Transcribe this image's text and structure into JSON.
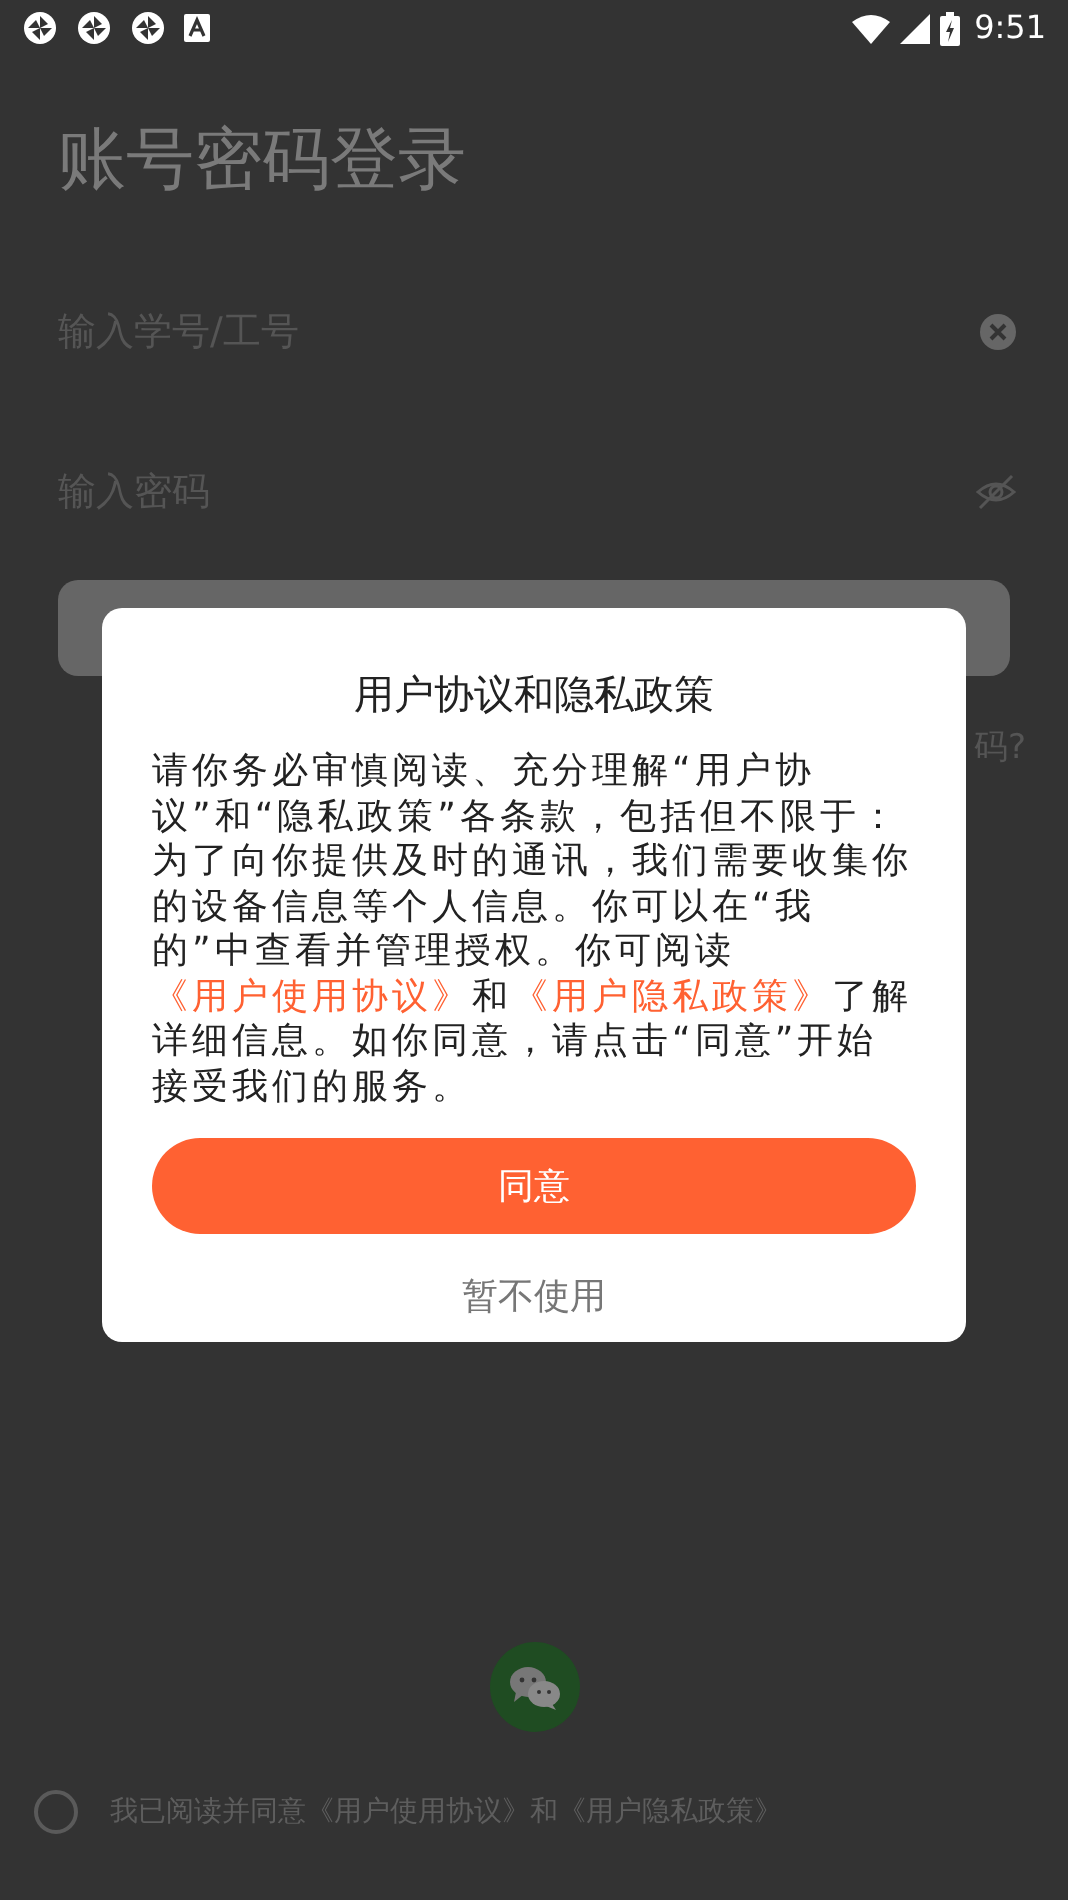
{
  "status_bar": {
    "time": "9:51"
  },
  "page": {
    "title": "账号密码登录",
    "account_field": {
      "placeholder": "输入学号/工号"
    },
    "password_field": {
      "placeholder": "输入密码"
    },
    "forgot_link": "码?"
  },
  "agreement": {
    "checked": false,
    "text": "我已阅读并同意《用户使用协议》和《用户隐私政策》"
  },
  "dialog": {
    "title": "用户协议和隐私政策",
    "body": [
      {
        "kind": "plain",
        "text": "请你务必审慎阅读、充分理解“用户协议”和“隐私政策”各条款，包括但不限于：为了向你提供及时的通讯，我们需要收集你的设备信息等个人信息。你可以在“我的”中查看并管理授权。你可阅读"
      },
      {
        "kind": "link",
        "text": "《用户使用协议》"
      },
      {
        "kind": "plain",
        "text": "和"
      },
      {
        "kind": "link",
        "text": "《用户隐私政策》"
      },
      {
        "kind": "plain",
        "text": "了解详细信息。如你同意，请点击“同意”开始接受我们的服务。"
      }
    ],
    "buttons": [
      {
        "kind": "primary",
        "label": "同意"
      },
      {
        "kind": "secondary",
        "label": "暂不使用"
      }
    ]
  }
}
